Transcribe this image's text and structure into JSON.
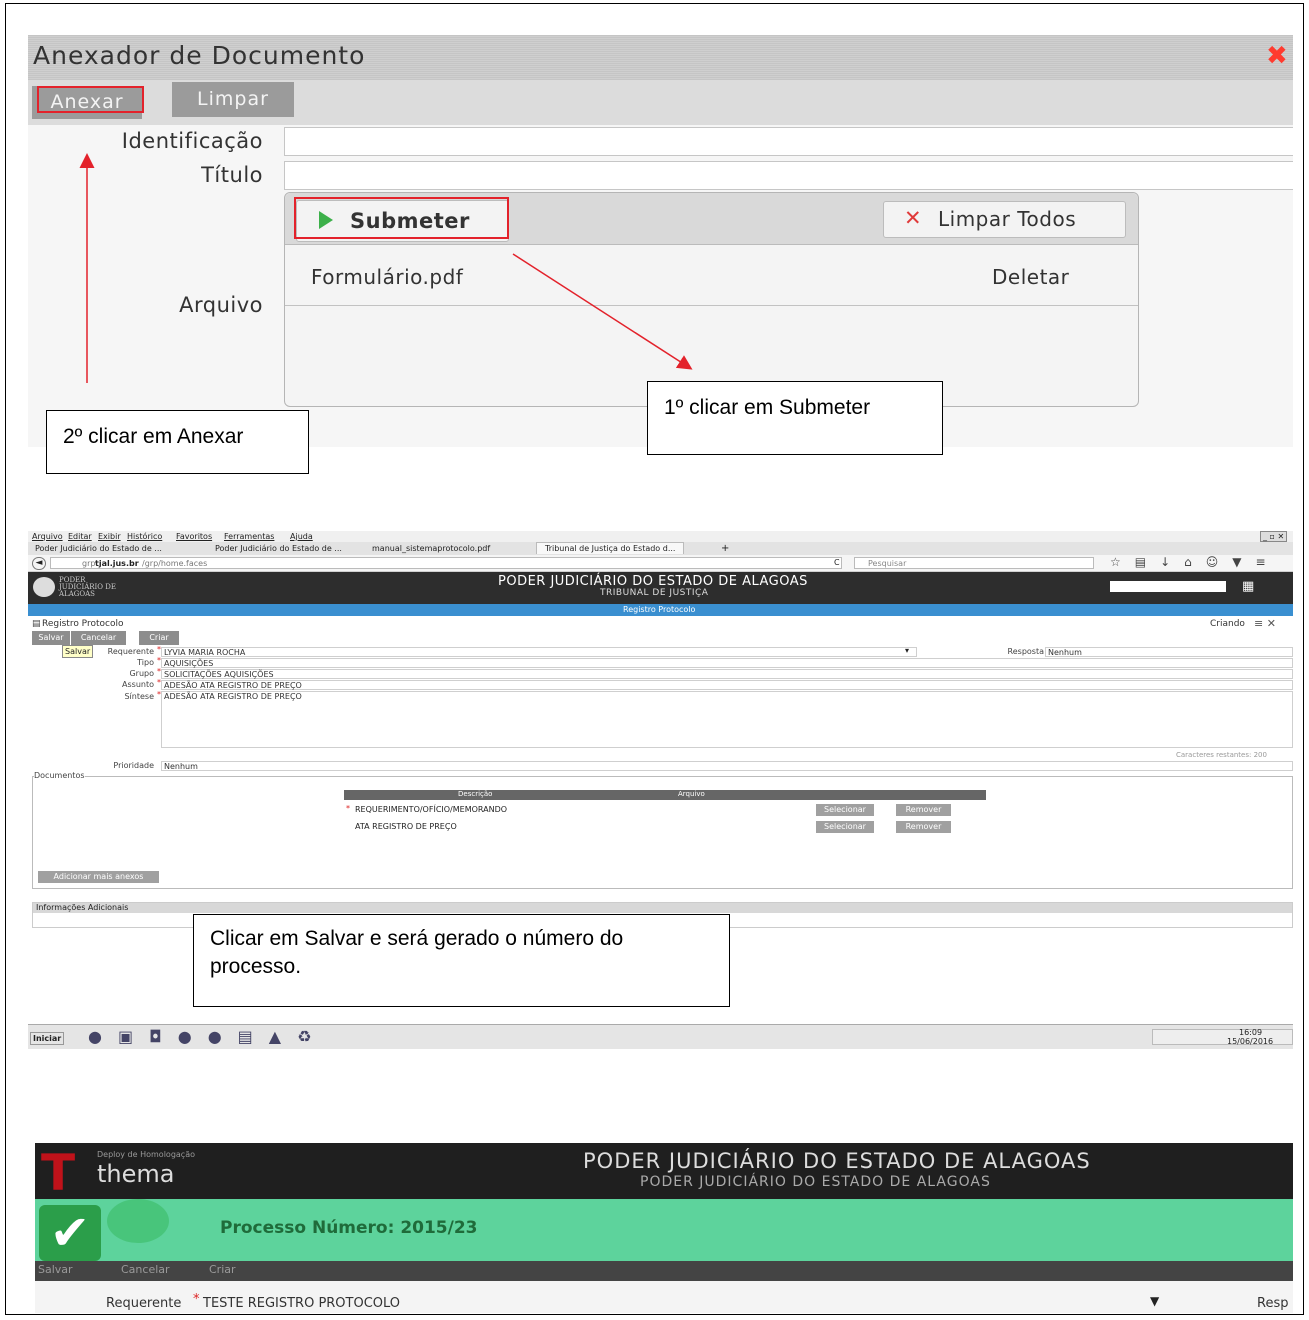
{
  "dialog": {
    "title": "Anexador de Documento",
    "close_icon": "close-icon",
    "btn_anexar": "Anexar",
    "btn_limpar": "Limpar",
    "label_identificacao": "Identificação",
    "label_titulo": "Título",
    "label_arquivo": "Arquivo",
    "btn_submeter": "Submeter",
    "btn_limpar_todos": "Limpar Todos",
    "file_name": "Formulário.pdf",
    "file_delete": "Deletar"
  },
  "annotations": {
    "note1": "1º clicar em Submeter",
    "note2": "2º clicar em Anexar",
    "note3": "Clicar em Salvar e será gerado o número do processo."
  },
  "browser": {
    "menu": [
      "Arquivo",
      "Editar",
      "Exibir",
      "Histórico",
      "Favoritos",
      "Ferramentas",
      "Ajuda"
    ],
    "tabs": [
      "Poder Judiciário do Estado de ...",
      "Poder Judiciário do Estado de ...",
      "manual_sistemaprotocolo.pdf",
      "Tribunal de Justiça do Estado d..."
    ],
    "url_prefix": "grp.",
    "url_host": "tjal.jus.br",
    "url_path": "/grp/home.faces",
    "search_placeholder": "Pesquisar"
  },
  "app": {
    "logo_text": "PODER JUDICIÁRIO DE ALAGOAS",
    "header_title": "PODER JUDICIÁRIO DO ESTADO DE ALAGOAS",
    "header_subtitle": "TRIBUNAL DE JUSTIÇA",
    "bar_title": "Registro Protocolo",
    "section_title": "Registro Protocolo",
    "status": "Criando",
    "btn_salvar": "Salvar",
    "btn_cancelar": "Cancelar",
    "btn_criar": "Criar",
    "tooltip": "Salvar",
    "label_requerente": "Requerente",
    "value_requerente": "LYVIA MARIA ROCHA",
    "label_resposta": "Resposta",
    "value_resposta": "Nenhum",
    "label_tipo": "Tipo",
    "value_tipo": "AQUISIÇÕES",
    "label_grupo": "Grupo",
    "value_grupo": "SOLICITAÇÕES AQUISIÇÕES",
    "label_assunto": "Assunto",
    "value_assunto": "ADESÃO ATA REGISTRO DE PREÇO",
    "label_sintese": "Síntese",
    "value_sintese": "ADESÃO ATA REGISTRO DE PREÇO",
    "chars_left": "Caracteres restantes: 200",
    "label_prioridade": "Prioridade",
    "value_prioridade": "Nenhum",
    "documentos": "Documentos",
    "col_descricao": "Descrição",
    "col_arquivo": "Arquivo",
    "doc_rows": [
      {
        "desc": "REQUERIMENTO/OFÍCIO/MEMORANDO",
        "sel": "Selecionar",
        "rem": "Remover"
      },
      {
        "desc": "ATA REGISTRO DE PREÇO",
        "sel": "Selecionar",
        "rem": "Remover"
      }
    ],
    "btn_add_anexos": "Adicionar mais anexos",
    "info_adicionais": "Informações Adicionais"
  },
  "taskbar": {
    "start": "Iniciar",
    "time": "16:09",
    "date": "15/06/2016"
  },
  "result": {
    "deploy": "Deploy de Homologação",
    "brand": "thema",
    "title": "PODER JUDICIÁRIO DO ESTADO DE ALAGOAS",
    "subtitle": "PODER JUDICIÁRIO DO ESTADO DE ALAGOAS",
    "message": "Processo Número: 2015/23",
    "btn_salvar": "Salvar",
    "btn_cancelar": "Cancelar",
    "btn_criar": "Criar",
    "label_requerente": "Requerente",
    "value_requerente": "TESTE REGISTRO PROTOCOLO",
    "cut_label": "Resp"
  }
}
